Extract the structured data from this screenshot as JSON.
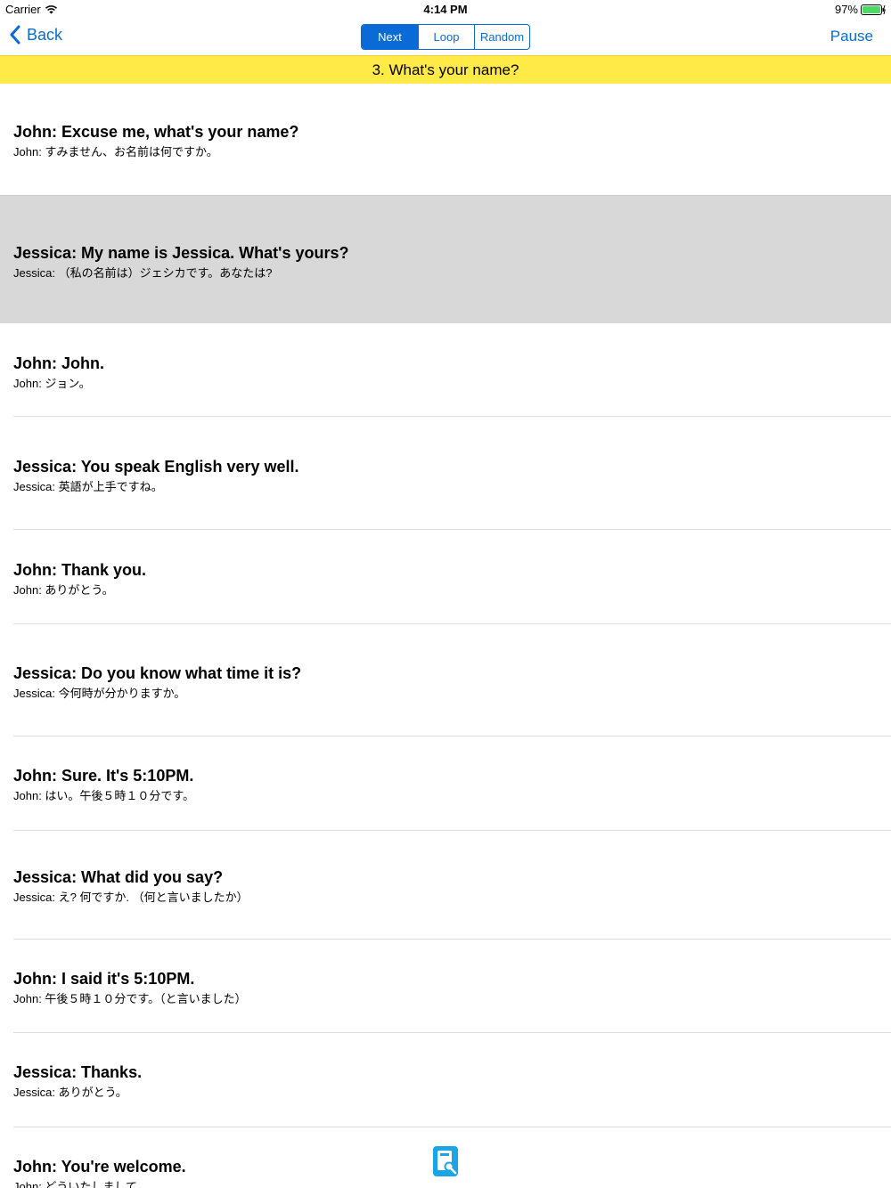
{
  "status_bar": {
    "carrier": "Carrier",
    "time": "4:14 PM",
    "battery": "97%"
  },
  "nav": {
    "back_label": "Back",
    "segments": [
      "Next",
      "Loop",
      "Random"
    ],
    "selected_segment": "Next",
    "pause_label": "Pause"
  },
  "lesson_title": "3. What's your name?",
  "dialogue": [
    {
      "english": "John: Excuse me, what's your name?",
      "japanese": "John: すみません、お名前は何ですか。"
    },
    {
      "english": "Jessica: My name is Jessica. What's yours?",
      "japanese": "Jessica: （私の名前は）ジェシカです。あなたは?",
      "selected": true
    },
    {
      "english": "John: John.",
      "japanese": "John: ジョン。"
    },
    {
      "english": "Jessica: You speak English very well.",
      "japanese": "Jessica: 英語が上手ですね。"
    },
    {
      "english": "John: Thank you.",
      "japanese": "John: ありがとう。"
    },
    {
      "english": "Jessica: Do you know what time it is?",
      "japanese": "Jessica: 今何時が分かりますか。"
    },
    {
      "english": "John: Sure. It's 5:10PM.",
      "japanese": "John: はい。午後５時１０分です。"
    },
    {
      "english": "Jessica: What did you say?",
      "japanese": "Jessica: え? 何ですか. （何と言いましたか）"
    },
    {
      "english": "John: I said it's 5:10PM.",
      "japanese": "John: 午後５時１０分です。（と言いました）"
    },
    {
      "english": "Jessica: Thanks.",
      "japanese": "Jessica: ありがとう。"
    },
    {
      "english": "John: You're welcome.",
      "japanese": "John: どういたしまして。"
    }
  ],
  "colors": {
    "accent": "#0a6bd6",
    "title_bar": "#ffea47",
    "selected_row": "#d8d8d8",
    "dictionary_icon": "#1aa6e6"
  },
  "icons": [
    "wifi-icon",
    "battery-icon",
    "back-chevron-icon",
    "dictionary-icon"
  ]
}
